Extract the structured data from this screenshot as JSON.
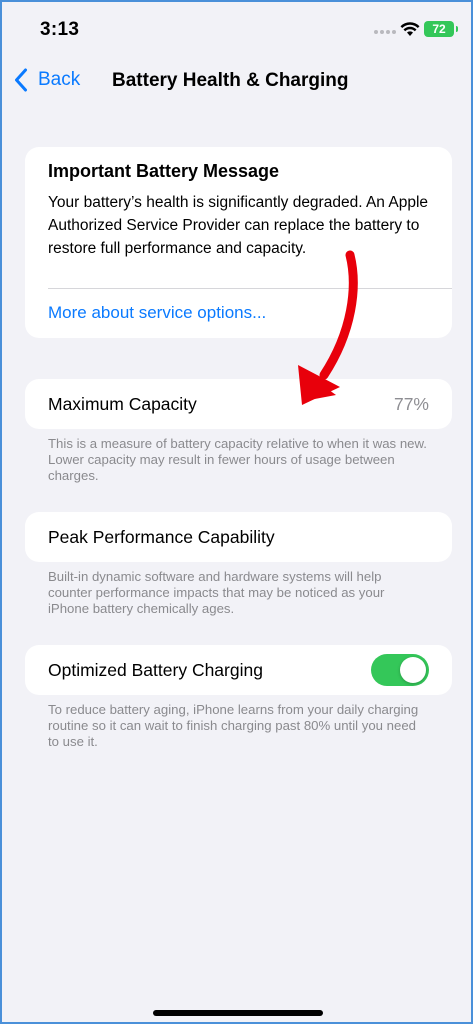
{
  "status_bar": {
    "time": "3:13",
    "battery_level": "72",
    "battery_color": "#34c759"
  },
  "nav": {
    "back_label": "Back",
    "title": "Battery Health & Charging",
    "accent_color": "#0a7aff"
  },
  "battery_message": {
    "title": "Important Battery Message",
    "body": "Your battery’s health is significantly degraded. An Apple Authorized Service Provider can replace the battery to restore full performance and capacity.",
    "link": "More about service options..."
  },
  "maximum_capacity": {
    "label": "Maximum Capacity",
    "value": "77%",
    "footnote": "This is a measure of battery capacity relative to when it was new. Lower capacity may result in fewer hours of usage between charges."
  },
  "peak_performance": {
    "label": "Peak Performance Capability",
    "footnote": "Built-in dynamic software and hardware systems will help counter performance impacts that may be noticed as your iPhone battery chemically ages."
  },
  "optimized_charging": {
    "label": "Optimized Battery Charging",
    "enabled": true,
    "footnote": "To reduce battery aging, iPhone learns from your daily charging routine so it can wait to finish charging past 80% until you need to use it."
  },
  "annotation": {
    "icon": "red-arrow-icon",
    "color": "#e8000b"
  }
}
